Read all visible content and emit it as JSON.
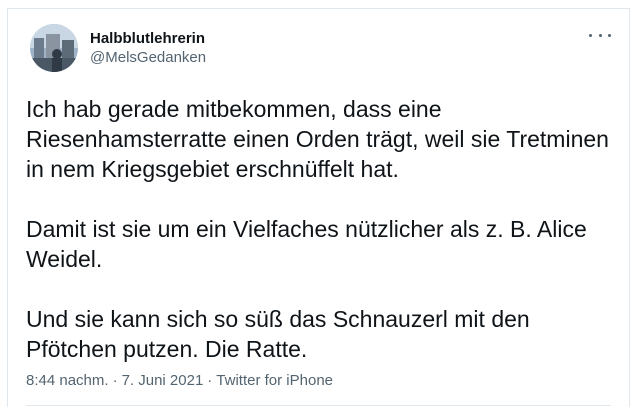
{
  "user": {
    "display_name": "Halbblutlehrerin",
    "handle": "@MelsGedanken"
  },
  "tweet": {
    "paragraphs": [
      "Ich hab gerade mitbekommen, dass eine Riesenhamsterratte einen Orden trägt, weil sie Tretminen in nem Kriegsgebiet erschnüffelt hat.",
      "Damit ist sie um ein Vielfaches nützlicher als z. B. Alice Weidel.",
      "Und sie kann sich so süß das Schnauzerl mit den Pfötchen putzen. Die Ratte."
    ],
    "time": "8:44 nachm.",
    "date": "7. Juni 2021",
    "source": "Twitter for iPhone",
    "separator": "·"
  },
  "icons": {
    "more": "more-horizontal-icon",
    "avatar": "profile-avatar"
  },
  "colors": {
    "text": "#0f1419",
    "secondary": "#536471",
    "border": "#e1e8ed"
  }
}
